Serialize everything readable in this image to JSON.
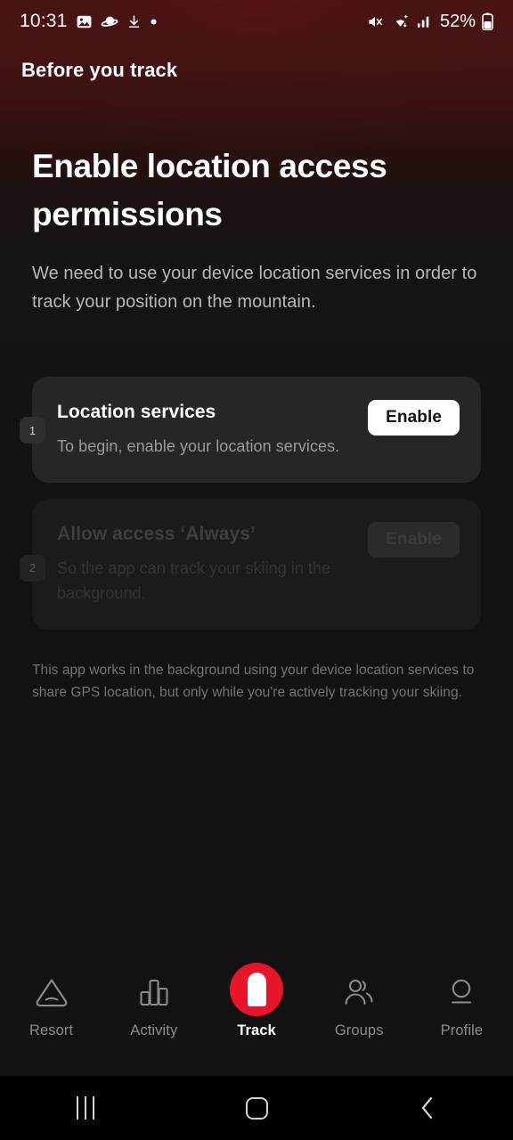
{
  "status_bar": {
    "time": "10:31",
    "left_icons": [
      "image-icon",
      "planet-icon",
      "download-icon",
      "dot-icon"
    ],
    "right_icons": [
      "mute-icon",
      "wifi-icon",
      "signal-icon"
    ],
    "battery_percent": "52%"
  },
  "header": {
    "title": "Before you track"
  },
  "main": {
    "headline": "Enable location access permissions",
    "subtext": "We need to use your device location services in order to track your position on the mountain.",
    "disclaimer": "This app works in the background using your device location services to share GPS location, but only while you're actively tracking your skiing."
  },
  "permission_cards": [
    {
      "step": "1",
      "title": "Location services",
      "description": "To begin, enable your location services.",
      "button_label": "Enable",
      "enabled": true
    },
    {
      "step": "2",
      "title": "Allow access ‘Always’",
      "description": "So the app can track your skiing in the background.",
      "button_label": "Enable",
      "enabled": false
    }
  ],
  "tab_bar": {
    "active": "Track",
    "accent_color": "#e8142a",
    "items": [
      {
        "label": "Resort",
        "icon": "mountain-triangle-icon"
      },
      {
        "label": "Activity",
        "icon": "bar-chart-icon"
      },
      {
        "label": "Track",
        "icon": "track-pin-icon"
      },
      {
        "label": "Groups",
        "icon": "people-icon"
      },
      {
        "label": "Profile",
        "icon": "person-circle-icon"
      }
    ]
  },
  "nav_bar": {
    "recents": "recents-icon",
    "home": "home-icon",
    "back": "back-icon"
  }
}
